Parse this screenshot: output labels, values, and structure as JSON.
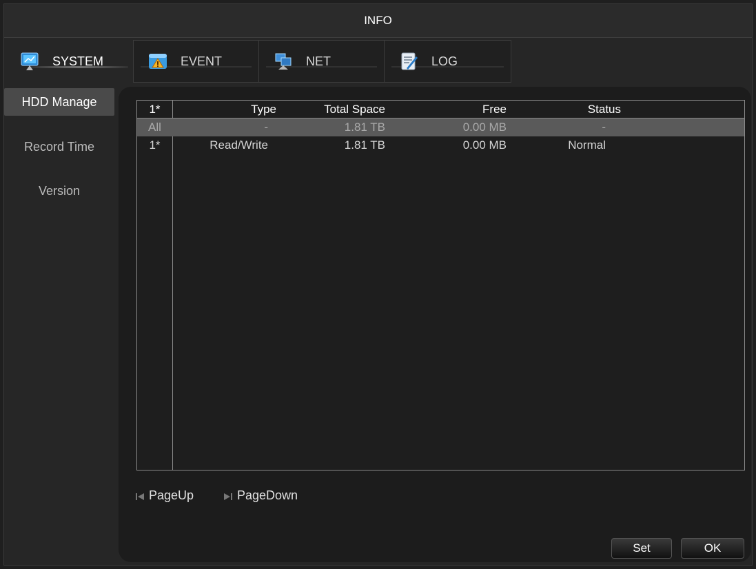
{
  "window": {
    "title": "INFO"
  },
  "tabs": [
    {
      "label": "SYSTEM",
      "icon": "monitor-icon",
      "active": true
    },
    {
      "label": "EVENT",
      "icon": "warning-icon",
      "active": false
    },
    {
      "label": "NET",
      "icon": "network-icon",
      "active": false
    },
    {
      "label": "LOG",
      "icon": "log-icon",
      "active": false
    }
  ],
  "sidebar": {
    "items": [
      {
        "label": "HDD Manage",
        "active": true
      },
      {
        "label": "Record Time",
        "active": false
      },
      {
        "label": "Version",
        "active": false
      }
    ]
  },
  "table": {
    "columns": [
      "1*",
      "Type",
      "Total Space",
      "Free",
      "Status"
    ],
    "rows": [
      {
        "idx": "All",
        "type": "-",
        "total": "1.81 TB",
        "free": "0.00 MB",
        "status": "-",
        "selected": true
      },
      {
        "idx": "1*",
        "type": "Read/Write",
        "total": "1.81 TB",
        "free": "0.00 MB",
        "status": "Normal",
        "selected": false
      }
    ]
  },
  "pager": {
    "page_up": "PageUp",
    "page_down": "PageDown"
  },
  "buttons": {
    "set": "Set",
    "ok": "OK"
  },
  "colors": {
    "selected_row": "#5a5a5a",
    "active_side": "#4a4a4a",
    "panel": "#1c1c1c"
  }
}
